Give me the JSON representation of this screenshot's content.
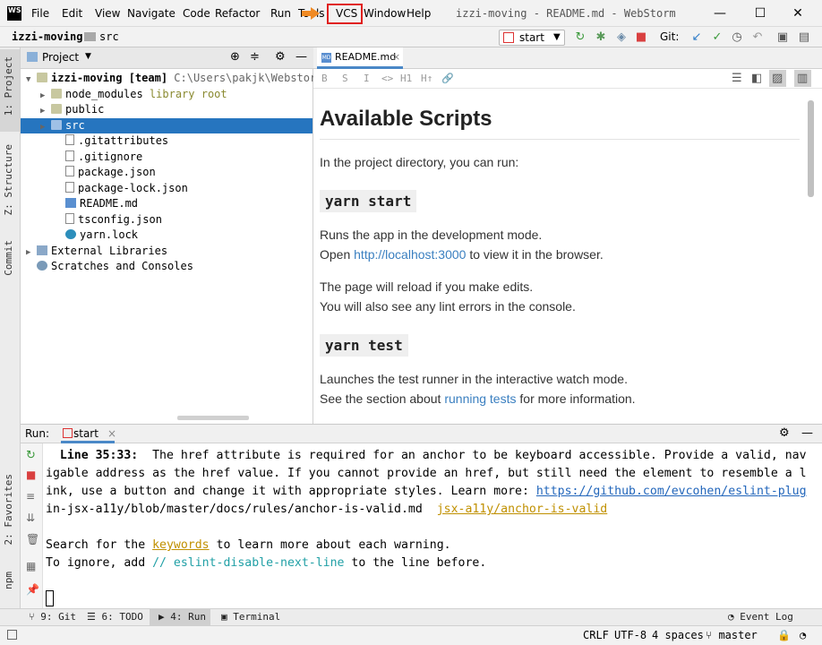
{
  "window": {
    "title": "izzi-moving - README.md - WebStorm",
    "logo_text": "WS",
    "controls": [
      "—",
      "☐",
      "✕"
    ]
  },
  "menu": [
    "File",
    "Edit",
    "View",
    "Navigate",
    "Code",
    "Refactor",
    "Run",
    "Tools",
    "VCS",
    "Window",
    "Help"
  ],
  "breadcrumb": {
    "project": "izzi-moving",
    "folder": "src"
  },
  "toolbar": {
    "run_config": "start",
    "git_label": "Git:"
  },
  "left_strip": [
    "1: Project",
    "Z: Structure",
    "Commit"
  ],
  "left_strip_bottom": [
    "2: Favorites",
    "npm"
  ],
  "project_panel": {
    "title": "Project",
    "tree": [
      {
        "label": "izzi-moving",
        "extra": "[team]",
        "path": "C:\\Users\\pakjk\\WebstormProje",
        "depth": 0,
        "caret": "▼",
        "type": "folder"
      },
      {
        "label": "node_modules",
        "extra": "library root",
        "depth": 1,
        "caret": "▶",
        "type": "folder-lib"
      },
      {
        "label": "public",
        "depth": 1,
        "caret": "▶",
        "type": "folder"
      },
      {
        "label": "src",
        "depth": 1,
        "caret": "▶",
        "type": "folder",
        "selected": true
      },
      {
        "label": ".gitattributes",
        "depth": 2,
        "type": "file"
      },
      {
        "label": ".gitignore",
        "depth": 2,
        "type": "file"
      },
      {
        "label": "package.json",
        "depth": 2,
        "type": "file"
      },
      {
        "label": "package-lock.json",
        "depth": 2,
        "type": "file"
      },
      {
        "label": "README.md",
        "depth": 2,
        "type": "md"
      },
      {
        "label": "tsconfig.json",
        "depth": 2,
        "type": "file"
      },
      {
        "label": "yarn.lock",
        "depth": 2,
        "type": "yarn"
      },
      {
        "label": "External Libraries",
        "depth": 0,
        "caret": "▶",
        "type": "lib"
      },
      {
        "label": "Scratches and Consoles",
        "depth": 0,
        "type": "scratch"
      }
    ]
  },
  "editor": {
    "tab": "README.md",
    "md_tools": [
      "B",
      "S",
      "I",
      "<>",
      "H1",
      "H↑",
      "🔗"
    ],
    "doc": {
      "h1": "Available Scripts",
      "intro": "In the project directory, you can run:",
      "s1_code": "yarn start",
      "s1_line1": "Runs the app in the development mode.",
      "s1_line2_pre": "Open ",
      "s1_link": "http://localhost:3000",
      "s1_line2_post": " to view it in the browser.",
      "s1_line3": "The page will reload if you make edits.",
      "s1_line4": "You will also see any lint errors in the console.",
      "s2_code": "yarn test",
      "s2_line1": "Launches the test runner in the interactive watch mode.",
      "s2_line2_pre": "See the section about ",
      "s2_link": "running tests",
      "s2_line2_post": " for more information."
    }
  },
  "run_panel": {
    "label": "Run:",
    "tab": "start",
    "console": {
      "l1_prefix": "  Line 35:33:",
      "l1_text": "  The href attribute is required for an anchor to be keyboard accessible. Provide a valid, nav",
      "l2": "igable address as the href value. If you cannot provide an href, but still need the element to resemble a l",
      "l3_text": "ink, use a button and change it with appropriate styles. Learn more: ",
      "l3_link": "https://github.com/evcohen/eslint-plug",
      "l4_text": "in-jsx-a11y/blob/master/docs/rules/anchor-is-valid.md  ",
      "l4_link": "jsx-a11y/anchor-is-valid",
      "l5_pre": "Search for the ",
      "l5_link": "keywords",
      "l5_post": " to learn more about each warning.",
      "l6_pre": "To ignore, add ",
      "l6_code": "// eslint-disable-next-line",
      "l6_post": " to the line before."
    }
  },
  "bottom_tabs": [
    "9: Git",
    "6: TODO",
    "4: Run",
    "Terminal",
    "Event Log"
  ],
  "status": {
    "line_sep": "CRLF",
    "encoding": "UTF-8",
    "indent": "4 spaces",
    "branch": "master"
  }
}
